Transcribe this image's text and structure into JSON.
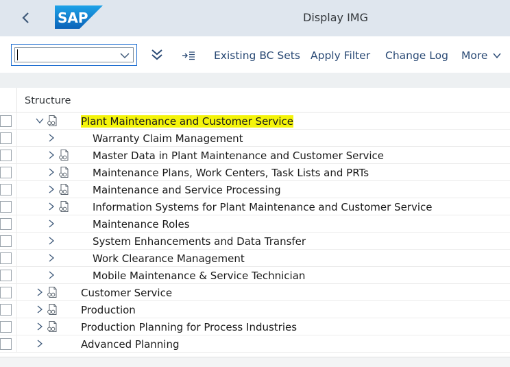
{
  "header": {
    "title": "Display IMG",
    "logo_text": "SAP"
  },
  "toolbar": {
    "command_value": "",
    "items": {
      "bc_sets": "Existing BC Sets",
      "apply_filter": "Apply Filter",
      "change_log": "Change Log",
      "more": "More"
    }
  },
  "tree": {
    "column_header": "Structure",
    "rows": [
      {
        "label": "Plant Maintenance and Customer Service",
        "expanded": true,
        "icon": true,
        "indent": 0,
        "highlight": true
      },
      {
        "label": "Warranty Claim Management",
        "expanded": false,
        "icon": false,
        "indent": 1
      },
      {
        "label": "Master Data in Plant Maintenance and Customer Service",
        "expanded": false,
        "icon": true,
        "indent": 1
      },
      {
        "label": "Maintenance Plans, Work Centers, Task Lists and PRTs",
        "expanded": false,
        "icon": true,
        "indent": 1
      },
      {
        "label": "Maintenance and Service Processing",
        "expanded": false,
        "icon": true,
        "indent": 1
      },
      {
        "label": "Information Systems for Plant Maintenance and Customer Service",
        "expanded": false,
        "icon": true,
        "indent": 1
      },
      {
        "label": "Maintenance Roles",
        "expanded": false,
        "icon": false,
        "indent": 1
      },
      {
        "label": "System Enhancements and Data Transfer",
        "expanded": false,
        "icon": false,
        "indent": 1
      },
      {
        "label": "Work Clearance Management",
        "expanded": false,
        "icon": false,
        "indent": 1
      },
      {
        "label": "Mobile Maintenance & Service Technician",
        "expanded": false,
        "icon": false,
        "indent": 1
      },
      {
        "label": "Customer Service",
        "expanded": false,
        "icon": true,
        "indent": 0
      },
      {
        "label": "Production",
        "expanded": false,
        "icon": true,
        "indent": 0
      },
      {
        "label": "Production Planning for Process Industries",
        "expanded": false,
        "icon": true,
        "indent": 0
      },
      {
        "label": "Advanced Planning",
        "expanded": false,
        "icon": false,
        "indent": 0
      }
    ]
  },
  "colors": {
    "shell_bg": "#dfe6ee",
    "highlight": "#f4f40a",
    "link": "#2a4a75",
    "sap_blue": "#0a6ed1"
  }
}
